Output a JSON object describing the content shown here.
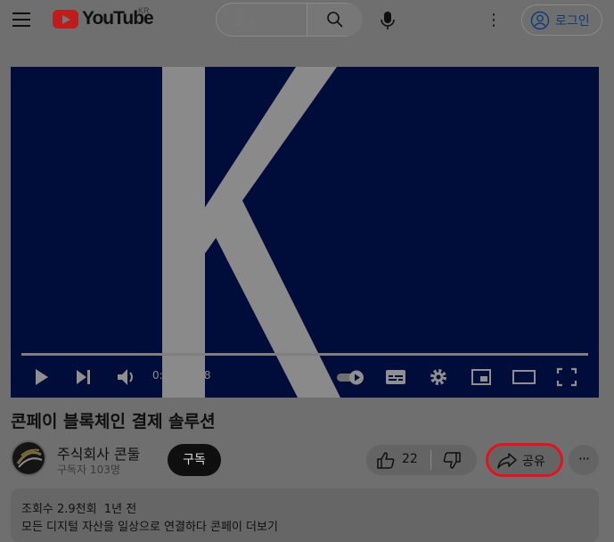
{
  "header": {
    "logo_text": "YouTube",
    "logo_region": "KR",
    "search_placeholder": "검색",
    "login_label": "로그인"
  },
  "player": {
    "time": "0:00 / 0:28",
    "progress": 0
  },
  "video": {
    "title": "콘페이 블록체인 결제 솔루션",
    "channel_name": "주식회사 콘둘",
    "subscribers": "구독자 103명",
    "subscribe_label": "구독",
    "like_count": "22",
    "share_label": "공유",
    "more_label": "···"
  },
  "description": {
    "views": "조회수 2.9천회",
    "age": "1년 전",
    "text": "모든 디지털 자산을 일상으로 연결하다 콘페이 더보기"
  },
  "colors": {
    "highlight": "#e8101f",
    "video_bg": "#000d3b"
  }
}
